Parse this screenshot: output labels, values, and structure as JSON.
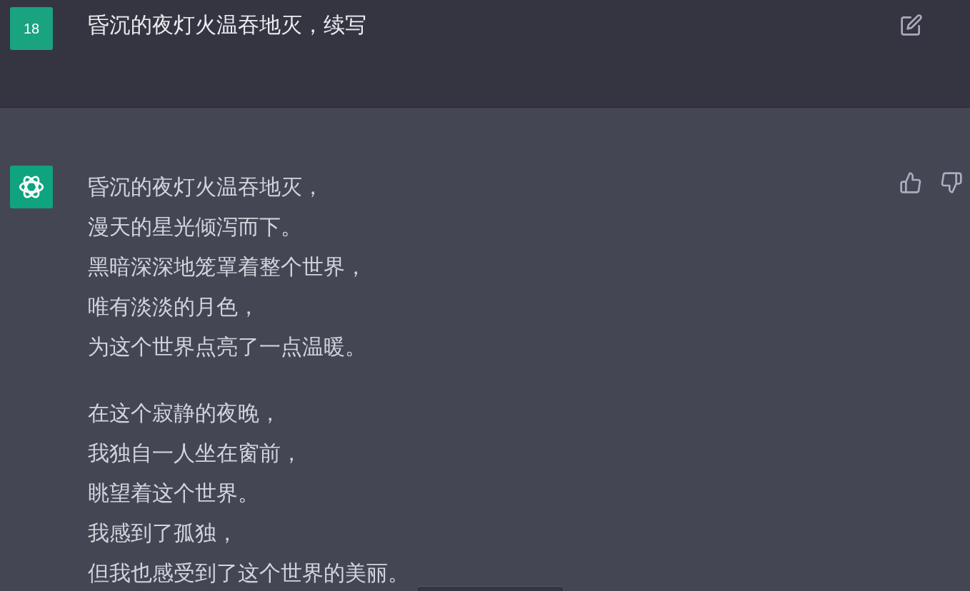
{
  "user_message": {
    "avatar_text": "18",
    "text": "昏沉的夜灯火温吞地灭，续写"
  },
  "assistant_message": {
    "paragraphs": [
      [
        "昏沉的夜灯火温吞地灭，",
        "漫天的星光倾泻而下。",
        "黑暗深深地笼罩着整个世界，",
        "唯有淡淡的月色，",
        "为这个世界点亮了一点温暖。"
      ],
      [
        "在这个寂静的夜晚，",
        "我独自一人坐在窗前，",
        "眺望着这个世界。",
        "我感到了孤独，",
        "但我也感受到了这个世界的美丽。"
      ]
    ]
  }
}
